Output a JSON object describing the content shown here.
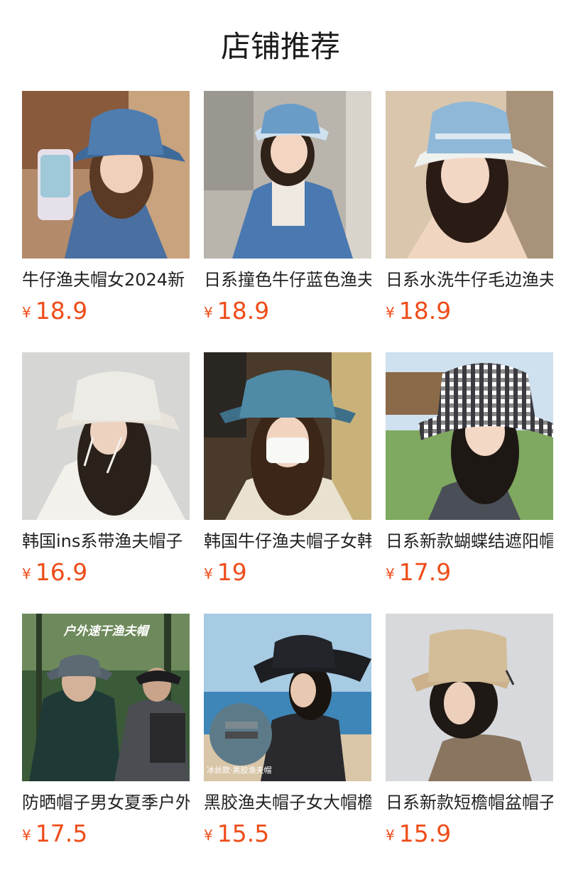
{
  "page": {
    "title": "店铺推荐"
  },
  "products": [
    {
      "name": "牛仔渔夫帽女2024新",
      "currency": "¥",
      "price": "18.9",
      "photo": "woman-denim-bucket-hat-selfie"
    },
    {
      "name": "日系撞色牛仔蓝色渔夫",
      "currency": "¥",
      "price": "18.9",
      "photo": "woman-denim-bucket-hat-jacket"
    },
    {
      "name": "日系水洗牛仔毛边渔夫",
      "currency": "¥",
      "price": "18.9",
      "photo": "woman-frayed-denim-bucket-hat"
    },
    {
      "name": "韩国ins系带渔夫帽子",
      "currency": "¥",
      "price": "16.9",
      "photo": "woman-white-drawstring-bucket-hat"
    },
    {
      "name": "韩国牛仔渔夫帽子女韩",
      "currency": "¥",
      "price": "19",
      "photo": "woman-denim-hat-face-mask"
    },
    {
      "name": "日系新款蝴蝶结遮阳帽",
      "currency": "¥",
      "price": "17.9",
      "photo": "woman-gingham-bucket-hat"
    },
    {
      "name": "防晒帽子男女夏季户外",
      "currency": "¥",
      "price": "17.5",
      "photo": "hikers-outdoor-hats",
      "overlay": "户外速干渔夫帽"
    },
    {
      "name": "黑胶渔夫帽子女大帽檐",
      "currency": "¥",
      "price": "15.5",
      "photo": "woman-black-sun-hat-beach",
      "overlay": "冰丝款·黑胶渔夫帽"
    },
    {
      "name": "日系新款短檐帽盆帽子",
      "currency": "¥",
      "price": "15.9",
      "photo": "woman-beige-bucket-hat"
    }
  ],
  "colors": {
    "price": "#ee4d1a",
    "title": "#1a1a1a"
  }
}
